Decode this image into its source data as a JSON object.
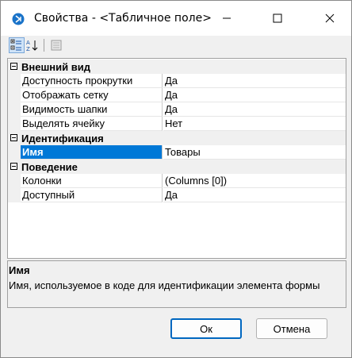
{
  "window": {
    "title": "Свойства - <Табличное поле>"
  },
  "toolbar": {
    "categorized_icon": "categorized-view-icon",
    "alphabetical_icon": "alphabetical-sort-icon",
    "pages_icon": "property-pages-icon"
  },
  "grid": {
    "categories": [
      {
        "label": "Внешний вид",
        "rows": [
          {
            "name": "Доступность прокрутки",
            "value": "Да"
          },
          {
            "name": "Отображать сетку",
            "value": "Да"
          },
          {
            "name": "Видимость шапки",
            "value": "Да"
          },
          {
            "name": "Выделять ячейку",
            "value": "Нет"
          }
        ]
      },
      {
        "label": "Идентификация",
        "rows": [
          {
            "name": "Имя",
            "value": "Товары"
          }
        ]
      },
      {
        "label": "Поведение",
        "rows": [
          {
            "name": "Колонки",
            "value": "(Columns [0])"
          },
          {
            "name": "Доступный",
            "value": "Да"
          }
        ]
      }
    ]
  },
  "description": {
    "title": "Имя",
    "text": "Имя, используемое в коде для идентификации элемента формы"
  },
  "buttons": {
    "ok": "Ок",
    "cancel": "Отмена"
  },
  "colors": {
    "selection": "#0078d7",
    "app_icon": "#1a73c9"
  }
}
